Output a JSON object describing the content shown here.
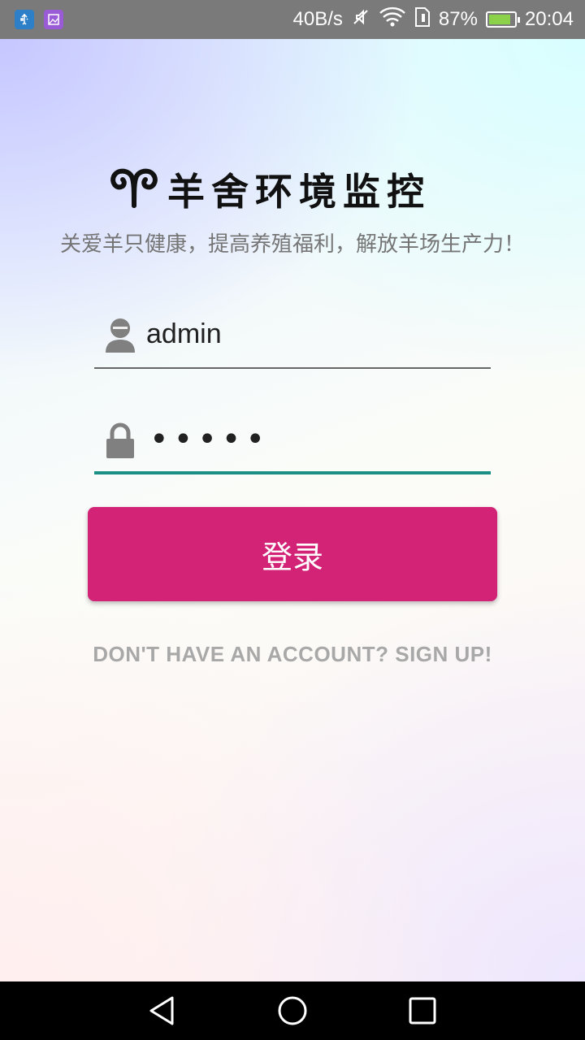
{
  "status_bar": {
    "net_speed": "40B/s",
    "battery_percent": "87%",
    "battery_level": 0.87,
    "time": "20:04",
    "icons": [
      "usb-icon",
      "gallery-icon",
      "mute-icon",
      "wifi-icon",
      "sim-icon",
      "battery-charging-icon"
    ]
  },
  "app": {
    "title": "羊舍环境监控",
    "slogan": "关爱羊只健康，提高养殖福利，解放羊场生产力！"
  },
  "form": {
    "username": "admin",
    "password_mask": "•••••",
    "login_label": "登录",
    "signup_label": "DON'T HAVE AN ACCOUNT? SIGN UP!"
  },
  "colors": {
    "accent": "#d32376",
    "focus_underline": "#1b8f86",
    "status_bar": "#7a7a7a",
    "battery": "#8bd14a"
  },
  "nav_bar": {
    "buttons": [
      "back-icon",
      "home-icon",
      "recents-icon"
    ]
  }
}
